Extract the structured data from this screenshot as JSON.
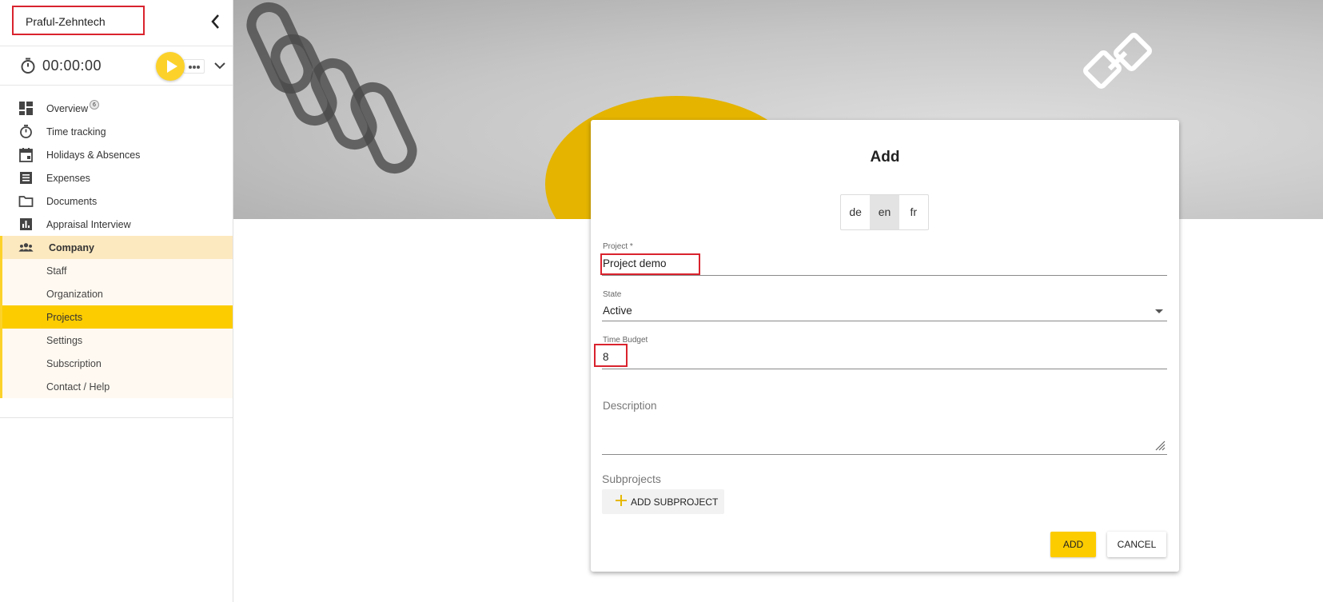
{
  "sidebar": {
    "company_name": "Praful-Zehntech",
    "timer": "00:00:00",
    "nav": [
      {
        "label": "Overview",
        "icon": "dashboard-icon",
        "badge": "6"
      },
      {
        "label": "Time tracking",
        "icon": "stopwatch-icon"
      },
      {
        "label": "Holidays & Absences",
        "icon": "calendar-icon"
      },
      {
        "label": "Expenses",
        "icon": "receipt-icon"
      },
      {
        "label": "Documents",
        "icon": "folder-icon"
      },
      {
        "label": "Appraisal Interview",
        "icon": "bar-chart-icon"
      }
    ],
    "company": {
      "label": "Company",
      "icon": "people-icon"
    },
    "company_sub": [
      {
        "label": "Staff"
      },
      {
        "label": "Organization"
      },
      {
        "label": "Projects",
        "active": true
      },
      {
        "label": "Settings"
      },
      {
        "label": "Subscription"
      },
      {
        "label": "Contact / Help"
      }
    ]
  },
  "dialog": {
    "title": "Add",
    "languages": [
      "de",
      "en",
      "fr"
    ],
    "active_language": "en",
    "project": {
      "label": "Project *",
      "value": "Project demo"
    },
    "state": {
      "label": "State",
      "value": "Active"
    },
    "time_budget": {
      "label": "Time Budget",
      "value": "8"
    },
    "description": {
      "placeholder": "Description"
    },
    "subprojects": {
      "label": "Subprojects",
      "add_button": "ADD SUBPROJECT"
    },
    "add_button": "ADD",
    "cancel_button": "CANCEL"
  },
  "colors": {
    "accent": "#fccc00",
    "highlight_border": "#d9232e",
    "company_bg": "#fde9c0"
  }
}
